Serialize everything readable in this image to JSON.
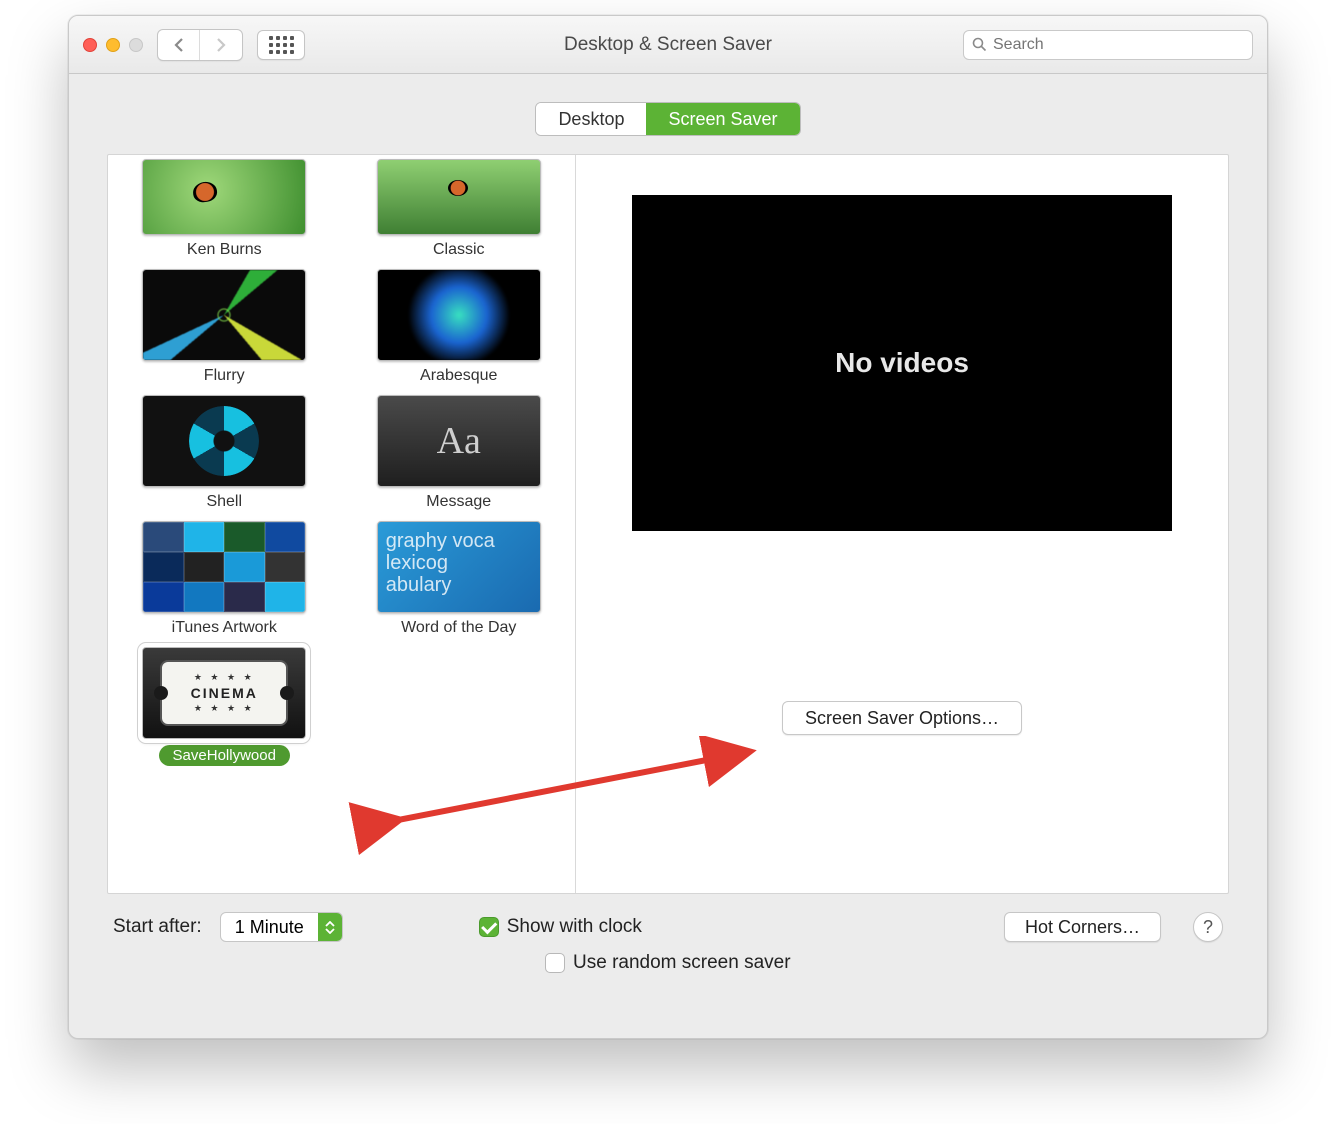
{
  "window_title": "Desktop & Screen Saver",
  "search": {
    "placeholder": "Search"
  },
  "tabs": {
    "desktop": "Desktop",
    "screensaver": "Screen Saver"
  },
  "screensavers": [
    {
      "id": "ken-burns",
      "label": "Ken Burns"
    },
    {
      "id": "classic",
      "label": "Classic"
    },
    {
      "id": "flurry",
      "label": "Flurry"
    },
    {
      "id": "arabesque",
      "label": "Arabesque"
    },
    {
      "id": "shell",
      "label": "Shell"
    },
    {
      "id": "message",
      "label": "Message",
      "sample": "Aa"
    },
    {
      "id": "itunes-artwork",
      "label": "iTunes Artwork"
    },
    {
      "id": "word-of-the-day",
      "label": "Word of the Day",
      "sample_lines": [
        "graphy  voca",
        "    lexicog",
        "abulary"
      ]
    },
    {
      "id": "savehollywood",
      "label": "SaveHollywood",
      "ticket_text": "CINEMA",
      "selected": true
    }
  ],
  "preview": {
    "message": "No videos"
  },
  "options_button": "Screen Saver Options…",
  "bottom": {
    "start_after_label": "Start after:",
    "start_after_value": "1 Minute",
    "show_clock": "Show with clock",
    "show_clock_checked": true,
    "random": "Use random screen saver",
    "random_checked": false,
    "hot_corners": "Hot Corners…",
    "help": "?"
  }
}
